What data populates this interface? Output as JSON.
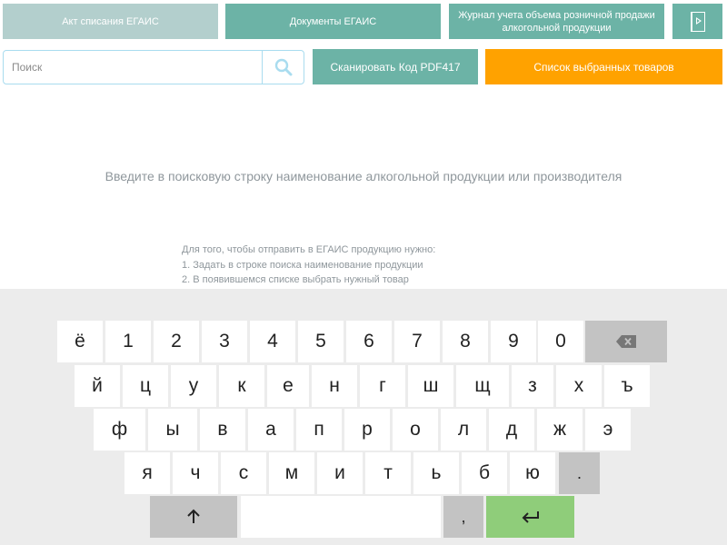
{
  "header": {
    "act_label": "Акт списания ЕГАИС",
    "docs_label": "Документы ЕГАИС",
    "journal_label_line1": "Журнал учета объема розничной продажи",
    "journal_label_line2": "алкогольной продукции",
    "exit_icon": "exit-icon"
  },
  "search": {
    "placeholder": "Поиск",
    "value": "",
    "button_icon": "search-icon"
  },
  "actions": {
    "scan_label": "Сканировать Код PDF417",
    "selected_label": "Список выбранных товаров"
  },
  "hint": {
    "main": "Введите в поисковую строку наименование алкогольной продукции или производителя",
    "line1": "Для того, чтобы отправить в ЕГАИС продукцию нужно:",
    "line2": "1. Задать в строке поиска наименование продукции",
    "line3": "2. В появившемся списке выбрать нужный товар"
  },
  "keyboard": {
    "row1": [
      "ё",
      "1",
      "2",
      "3",
      "4",
      "5",
      "6",
      "7",
      "8",
      "9",
      "0"
    ],
    "row2": [
      "й",
      "ц",
      "у",
      "к",
      "е",
      "н",
      "г",
      "ш",
      "щ",
      "з",
      "х",
      "ъ"
    ],
    "row3": [
      "ф",
      "ы",
      "в",
      "а",
      "п",
      "р",
      "о",
      "л",
      "д",
      "ж",
      "э"
    ],
    "row4": [
      "я",
      "ч",
      "с",
      "м",
      "и",
      "т",
      "ь",
      "б",
      "ю",
      "."
    ],
    "comma": ",",
    "icons": {
      "backspace": "backspace-icon",
      "shift": "shift-arrow-icon",
      "enter": "enter-icon"
    }
  },
  "colors": {
    "teal": "#6cb3a6",
    "teal_light": "#b3cfcd",
    "orange": "#ffa200",
    "green": "#8fcd7a",
    "key_gray": "#c3c3c3",
    "keyboard_bg": "#ececec"
  }
}
